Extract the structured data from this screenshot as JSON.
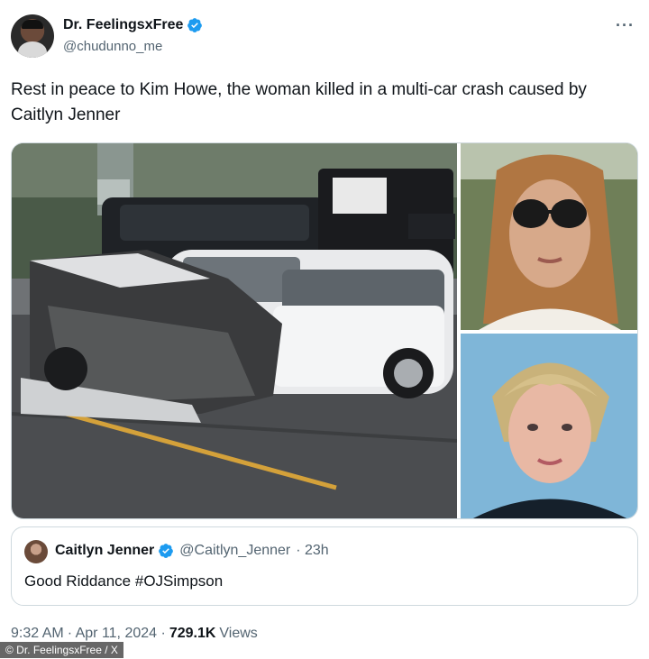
{
  "author": {
    "display_name": "Dr. FeelingsxFree",
    "handle": "@chudunno_me",
    "more_icon": "more-horizontal-icon"
  },
  "tweet": {
    "text": "Rest in peace to Kim Howe, the woman killed in a multi-car crash caused by Caitlyn Jenner"
  },
  "quote": {
    "display_name": "Caitlyn Jenner",
    "handle": "@Caitlyn_Jenner",
    "time": "· 23h",
    "text": "Good Riddance #OJSimpson"
  },
  "meta": {
    "time": "9:32 AM",
    "date": "· Apr 11, 2024 ·",
    "views_count": "729.1K",
    "views_label": "Views"
  },
  "watermark": "© Dr. FeelingsxFree / X",
  "colors": {
    "verified_blue": "#1d9bf0",
    "secondary_text": "#536471",
    "border": "#cfd9de"
  }
}
